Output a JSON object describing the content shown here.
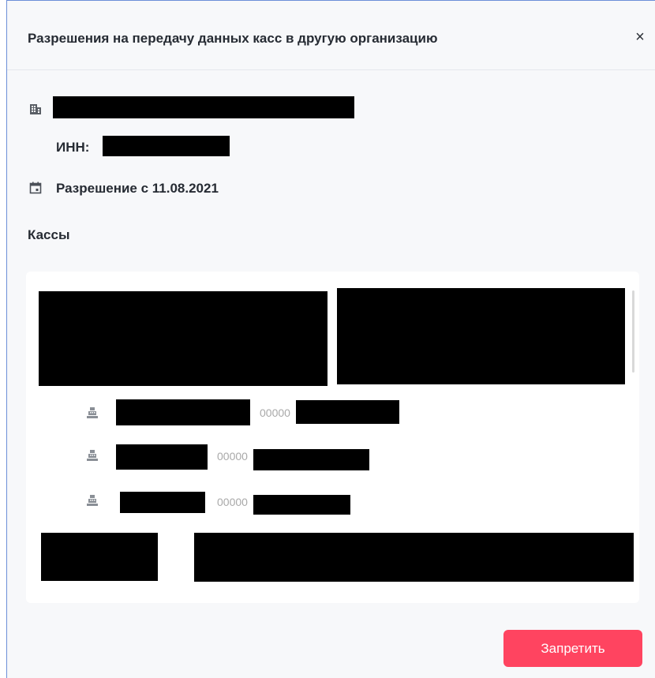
{
  "dialog": {
    "title": "Разрешения на передачу данных касс в другую организацию",
    "close_label": "×"
  },
  "organization": {
    "name": "[redacted]",
    "inn_label": "ИНН:",
    "inn_value": "[redacted]",
    "permission_text": "Разрешение с 11.08.2021"
  },
  "registers": {
    "section_title": "Кассы",
    "items": [
      {
        "name": "[redacted]",
        "serial_prefix": "00000",
        "serial_rest": "[redacted]"
      },
      {
        "name": "[redacted]",
        "serial_prefix": "00000",
        "serial_rest": "[redacted]"
      },
      {
        "name": "[redacted]",
        "serial_prefix": "00000",
        "serial_rest": "[redacted]"
      }
    ]
  },
  "actions": {
    "deny_label": "Запретить",
    "deny_color": "#ff4460"
  },
  "icons": {
    "organization": "building-icon",
    "permission": "calendar-icon",
    "register": "cash-register-icon"
  }
}
